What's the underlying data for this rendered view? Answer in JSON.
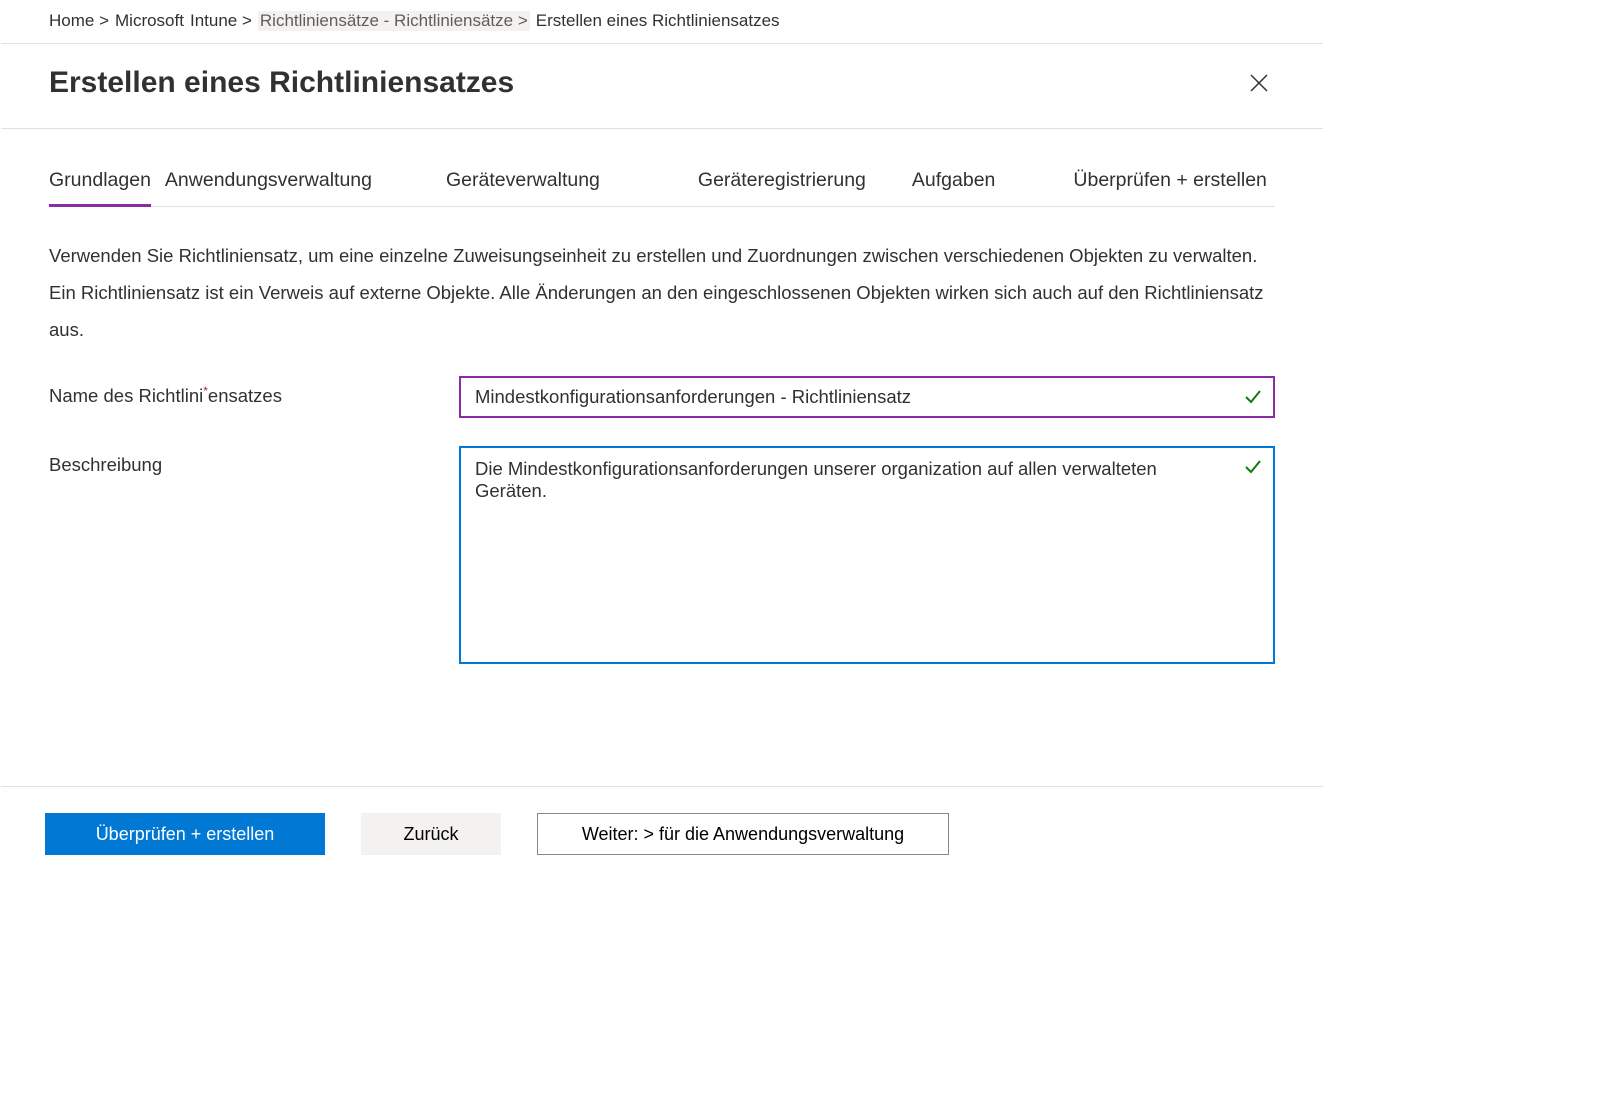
{
  "breadcrumb": {
    "items": [
      "Home >",
      "Microsoft",
      "Intune >",
      "Richtliniensätze - Richtliniensätze >"
    ],
    "current": "Erstellen eines Richtliniensatzes"
  },
  "header": {
    "title": "Erstellen eines Richtliniensatzes"
  },
  "tabs": [
    "Grundlagen",
    "Anwendungsverwaltung",
    "Geräteverwaltung",
    "Geräteregistrierung",
    "Aufgaben",
    "Überprüfen + erstellen"
  ],
  "intro_text": "Verwenden Sie Richtliniensatz, um eine einzelne Zuweisungseinheit zu erstellen und Zuordnungen zwischen verschiedenen Objekten zu verwalten. Ein Richtliniensatz ist ein Verweis auf externe Objekte. Alle Änderungen an den eingeschlossenen Objekten wirken sich auch auf den Richtliniensatz aus.",
  "form": {
    "name_label_part1": "Name des Richtlini",
    "name_label_star": "*",
    "name_label_part2": "ensatzes",
    "name_value": "Mindestkonfigurationsanforderungen - Richtliniensatz",
    "desc_label": "Beschreibung",
    "desc_value": "Die Mindestkonfigurationsanforderungen unserer organization auf allen verwalteten Geräten."
  },
  "footer": {
    "primary": "Überprüfen + erstellen",
    "back": "Zurück",
    "next": "Weiter: > für die Anwendungsverwaltung"
  }
}
